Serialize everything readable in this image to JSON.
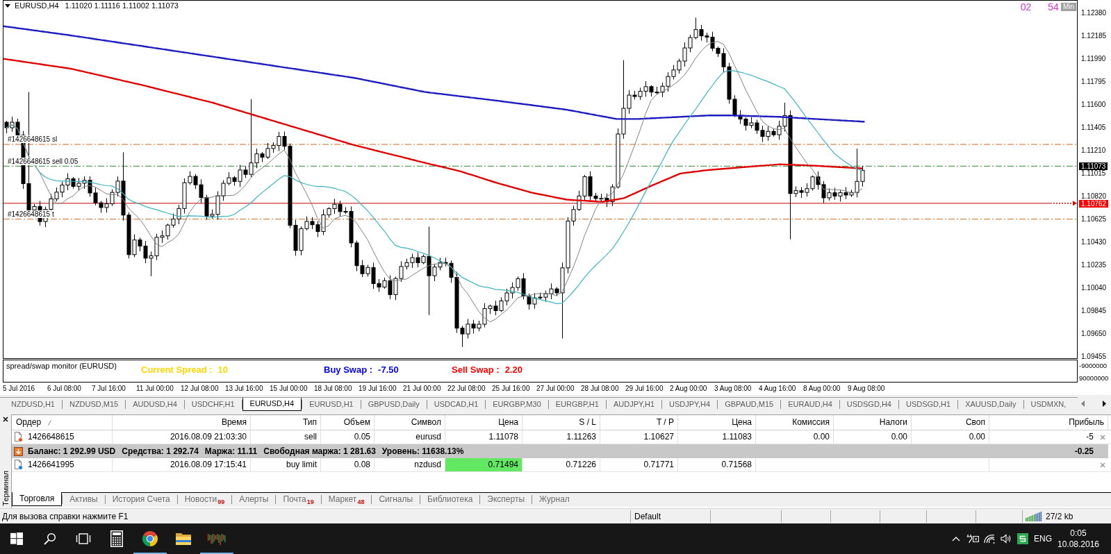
{
  "chart": {
    "title": "EURUSD,H4",
    "ohlc": "1.11020 1.11116 1.11002 1.11073",
    "timer": {
      "values": [
        "02",
        "54"
      ],
      "unit": "Min"
    },
    "order_lines": [
      {
        "label": "#1426648615 sl",
        "kind": "sl"
      },
      {
        "label": "#1426648615 sell 0.05",
        "kind": "entry"
      },
      {
        "label": "#1426648615 t",
        "kind": "tp"
      }
    ],
    "price_axis": {
      "ticks": [
        "1.12380",
        "1.12185",
        "1.11990",
        "1.11795",
        "1.11600",
        "1.11405",
        "1.11210",
        "1.11015",
        "1.10820",
        "1.10625",
        "1.10430",
        "1.10235",
        "1.10040",
        "1.09845",
        "1.09650",
        "1.09455"
      ],
      "markers": [
        {
          "text": "1.11073",
          "kind": "bid"
        },
        {
          "text": "1.10762",
          "kind": "alert"
        }
      ]
    },
    "indicator": {
      "name": "spread/swap monitor (EURUSD)",
      "stats": [
        {
          "label": "Current Spread :",
          "value": "10",
          "color": "#ffd700"
        },
        {
          "label": "Buy Swap :",
          "value": "-7.50",
          "color": "#0000ff"
        },
        {
          "label": "Sell Swap :",
          "value": "2.20",
          "color": "#ff0000"
        }
      ],
      "axis": [
        "-9000000",
        "90000000"
      ]
    },
    "time_axis": [
      "5 Jul 2016",
      "6 Jul 08:00",
      "7 Jul 16:00",
      "11 Jul 00:00",
      "12 Jul 08:00",
      "13 Jul 16:00",
      "15 Jul 00:00",
      "18 Jul 08:00",
      "19 Jul 16:00",
      "21 Jul 00:00",
      "22 Jul 08:00",
      "25 Jul 16:00",
      "27 Jul 00:00",
      "28 Jul 08:00",
      "29 Jul 16:00",
      "2 Aug 00:00",
      "3 Aug 08:00",
      "4 Aug 16:00",
      "8 Aug 00:00",
      "9 Aug 08:00"
    ]
  },
  "chart_tabs": [
    {
      "label": "NZDUSD,H1",
      "selected": false
    },
    {
      "label": "NZDUSD,M15",
      "selected": false
    },
    {
      "label": "AUDUSD,H4",
      "selected": false
    },
    {
      "label": "USDCHF,H1",
      "selected": false
    },
    {
      "label": "EURUSD,H4",
      "selected": true
    },
    {
      "label": "EURUSD,H1",
      "selected": false
    },
    {
      "label": "GBPUSD,Daily",
      "selected": false
    },
    {
      "label": "USDCAD,H1",
      "selected": false
    },
    {
      "label": "EURGBP,M30",
      "selected": false
    },
    {
      "label": "EURGBP,H1",
      "selected": false
    },
    {
      "label": "AUDJPY,H1",
      "selected": false
    },
    {
      "label": "USDJPY,H4",
      "selected": false
    },
    {
      "label": "GBPAUD,M15",
      "selected": false
    },
    {
      "label": "EURAUD,H4",
      "selected": false
    },
    {
      "label": "USDSGD,H4",
      "selected": false
    },
    {
      "label": "USDSGD,H1",
      "selected": false
    },
    {
      "label": "XAUUSD,Daily",
      "selected": false
    },
    {
      "label": "USDMXN,",
      "selected": false
    }
  ],
  "terminal": {
    "title": "Терминал",
    "columns": [
      {
        "label": "Ордер",
        "sorted": true
      },
      {
        "label": "Время",
        "sorted": false
      },
      {
        "label": "Тип",
        "sorted": false
      },
      {
        "label": "Объем",
        "sorted": false
      },
      {
        "label": "Символ",
        "sorted": false
      },
      {
        "label": "Цена",
        "sorted": false
      },
      {
        "label": "S / L",
        "sorted": false
      },
      {
        "label": "T / P",
        "sorted": false
      },
      {
        "label": "Цена",
        "sorted": false
      },
      {
        "label": "Комиссия",
        "sorted": false
      },
      {
        "label": "Налоги",
        "sorted": false
      },
      {
        "label": "Своп",
        "sorted": false
      },
      {
        "label": "Прибыль",
        "sorted": false
      }
    ],
    "rows": [
      {
        "kind": "market",
        "highlighted": false,
        "cells": [
          "1426648615",
          "2016.08.09 21:03:30",
          "sell",
          "0.05",
          "eurusd",
          "1.11078",
          "1.11263",
          "1.10627",
          "1.11083",
          "0.00",
          "0.00",
          "0.00",
          "-5"
        ]
      },
      {
        "kind": "summary",
        "items": [
          "Баланс: 1 292.99 USD",
          "Средства: 1 292.74",
          "Маржа: 11.11",
          "Свободная маржа: 1 281.63",
          "Уровень: 11638.13%"
        ],
        "profit": "-0.25"
      },
      {
        "kind": "pending",
        "highlighted": true,
        "cells": [
          "1426641995",
          "2016.08.09 17:15:41",
          "buy limit",
          "0.08",
          "nzdusd",
          "0.71494",
          "0.71226",
          "0.71771",
          "0.71568"
        ]
      }
    ],
    "tabs": [
      {
        "label": "Торговля",
        "selected": true
      },
      {
        "label": "Активы",
        "selected": false
      },
      {
        "label": "История Счета",
        "selected": false
      },
      {
        "label": "Новости",
        "count": "99",
        "selected": false
      },
      {
        "label": "Алерты",
        "selected": false
      },
      {
        "label": "Почта",
        "count": "19",
        "selected": false
      },
      {
        "label": "Маркет",
        "count": "48",
        "selected": false
      },
      {
        "label": "Сигналы",
        "selected": false
      },
      {
        "label": "Библиотека",
        "selected": false
      },
      {
        "label": "Эксперты",
        "selected": false
      },
      {
        "label": "Журнал",
        "selected": false
      }
    ]
  },
  "status_bar": {
    "hint": "Для вызова справки нажмите F1",
    "profile": "Default",
    "traffic": "27/2 kb"
  },
  "taskbar": {
    "apps": [
      {
        "kind": "calculator",
        "running": false
      },
      {
        "kind": "browser",
        "running": true
      },
      {
        "kind": "folder",
        "running": false
      },
      {
        "kind": "terminal",
        "running": true
      }
    ],
    "language": "ENG",
    "time": "0:05",
    "date": "10.08.2016"
  }
}
